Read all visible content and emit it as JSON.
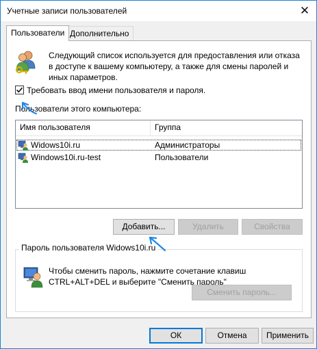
{
  "window": {
    "title": "Учетные записи пользователей",
    "close_glyph": "✕"
  },
  "tabs": [
    {
      "label": "Пользователи",
      "active": true
    },
    {
      "label": "Дополнительно",
      "active": false
    }
  ],
  "info": {
    "icon": "users-keys-icon",
    "text": "Следующий список используется для предоставления или отказа в доступе к вашему компьютеру, а также для смены паролей и иных параметров."
  },
  "require_login": {
    "label": "Требовать ввод имени пользователя и пароля.",
    "checked": true
  },
  "users_section": {
    "label": "Пользователи этого компьютера:",
    "columns": [
      "Имя пользователя",
      "Группа"
    ],
    "rows": [
      {
        "name": "Widows10i.ru",
        "group": "Администраторы",
        "selected": true
      },
      {
        "name": "Windows10i.ru-test",
        "group": "Пользователи",
        "selected": false
      }
    ]
  },
  "actions": {
    "add": "Добавить...",
    "remove": "Удалить",
    "properties": "Свойства"
  },
  "password_group": {
    "title": "Пароль пользователя Widows10i.ru",
    "text": "Чтобы сменить пароль, нажмите сочетание клавиш CTRL+ALT+DEL и выберите \"Сменить пароль\"",
    "button": "Сменить пароль..."
  },
  "footer": {
    "ok": "ОК",
    "cancel": "Отмена",
    "apply": "Применить"
  },
  "colors": {
    "accent": "#0078d7",
    "annotation_arrow": "#1e88e5"
  }
}
